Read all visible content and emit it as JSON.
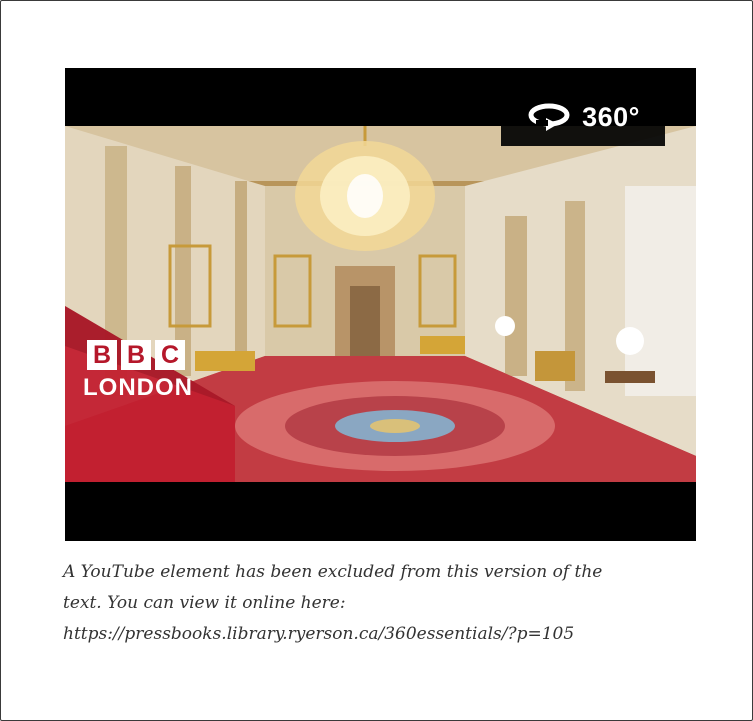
{
  "video": {
    "badge_label": "360°",
    "badge_icon": "rotate-360-icon",
    "logo": {
      "letters": [
        "B",
        "B",
        "C"
      ],
      "subtitle": "LONDON"
    },
    "colors": {
      "logo_red": "#b5172a",
      "background": "#000000"
    }
  },
  "caption": {
    "line1": "A YouTube element has been excluded from this version of the",
    "line2": "text. You can view it online here:",
    "line3": "https://pressbooks.library.ryerson.ca/360essentials/?p=105"
  }
}
